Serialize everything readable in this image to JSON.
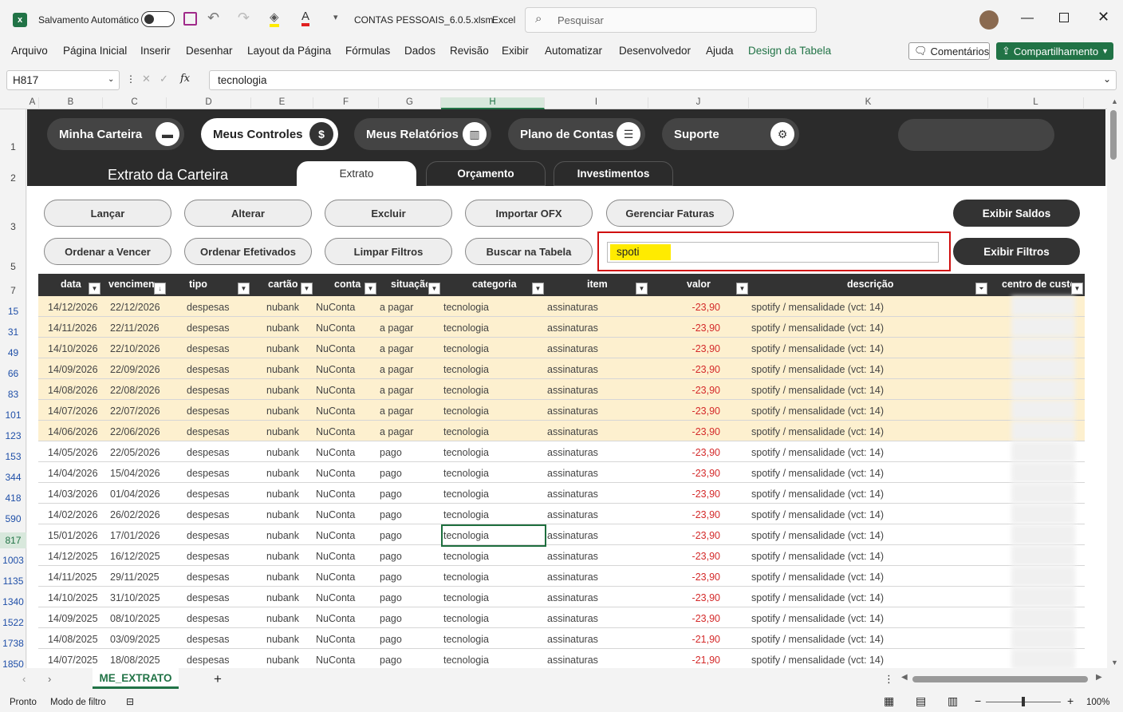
{
  "app": {
    "autosave_label": "Salvamento Automático",
    "file_title": "CONTAS PESSOAIS_6.0.5.xlsm",
    "app_name": "Excel",
    "search_placeholder": "Pesquisar"
  },
  "menu": [
    "Arquivo",
    "Página Inicial",
    "Inserir",
    "Desenhar",
    "Layout da Página",
    "Fórmulas",
    "Dados",
    "Revisão",
    "Exibir",
    "Automatizar",
    "Desenvolvedor",
    "Ajuda",
    "Design da Tabela"
  ],
  "ribbon_right": {
    "comments": "Comentários",
    "share": "Compartilhamento"
  },
  "formula_bar": {
    "name_box": "H817",
    "fx": "fx",
    "value": "tecnologia"
  },
  "columns": [
    "A",
    "B",
    "C",
    "D",
    "E",
    "F",
    "G",
    "H",
    "I",
    "J",
    "K",
    "L"
  ],
  "row_headers": [
    "1",
    "2",
    "3",
    "5",
    "7",
    "15",
    "31",
    "49",
    "66",
    "83",
    "101",
    "123",
    "153",
    "344",
    "418",
    "590",
    "817",
    "1003",
    "1135",
    "1340",
    "1522",
    "1738",
    "1850"
  ],
  "nav": [
    {
      "label": "Minha Carteira",
      "icon": "wallet-icon",
      "glyph": "▬"
    },
    {
      "label": "Meus Controles",
      "icon": "dollar-icon",
      "glyph": "$"
    },
    {
      "label": "Meus Relatórios",
      "icon": "chart-icon",
      "glyph": "▥"
    },
    {
      "label": "Plano de Contas",
      "icon": "list-icon",
      "glyph": "☰"
    },
    {
      "label": "Suporte",
      "icon": "gear-icon",
      "glyph": "⚙"
    }
  ],
  "section_title": "Extrato da Carteira",
  "tabs": [
    "Extrato",
    "Orçamento",
    "Investimentos"
  ],
  "actions_row1": [
    "Lançar",
    "Alterar",
    "Excluir",
    "Importar OFX",
    "Gerenciar Faturas"
  ],
  "actions_row2": [
    "Ordenar a Vencer",
    "Ordenar Efetivados",
    "Limpar Filtros",
    "Buscar na Tabela"
  ],
  "search_value": "spoti",
  "right_buttons": {
    "saldos": "Exibir Saldos",
    "filtros": "Exibir Filtros"
  },
  "table_headers": [
    "data",
    "vencimento",
    "tipo",
    "cartão",
    "conta",
    "situação",
    "categoria",
    "item",
    "valor",
    "descrição",
    "centro de custo"
  ],
  "rows": [
    [
      "14/12/2026",
      "22/12/2026",
      "despesas",
      "nubank",
      "NuConta",
      "a pagar",
      "tecnologia",
      "assinaturas",
      "-23,90",
      "spotify / mensalidade (vct: 14)"
    ],
    [
      "14/11/2026",
      "22/11/2026",
      "despesas",
      "nubank",
      "NuConta",
      "a pagar",
      "tecnologia",
      "assinaturas",
      "-23,90",
      "spotify / mensalidade (vct: 14)"
    ],
    [
      "14/10/2026",
      "22/10/2026",
      "despesas",
      "nubank",
      "NuConta",
      "a pagar",
      "tecnologia",
      "assinaturas",
      "-23,90",
      "spotify / mensalidade (vct: 14)"
    ],
    [
      "14/09/2026",
      "22/09/2026",
      "despesas",
      "nubank",
      "NuConta",
      "a pagar",
      "tecnologia",
      "assinaturas",
      "-23,90",
      "spotify / mensalidade (vct: 14)"
    ],
    [
      "14/08/2026",
      "22/08/2026",
      "despesas",
      "nubank",
      "NuConta",
      "a pagar",
      "tecnologia",
      "assinaturas",
      "-23,90",
      "spotify / mensalidade (vct: 14)"
    ],
    [
      "14/07/2026",
      "22/07/2026",
      "despesas",
      "nubank",
      "NuConta",
      "a pagar",
      "tecnologia",
      "assinaturas",
      "-23,90",
      "spotify / mensalidade (vct: 14)"
    ],
    [
      "14/06/2026",
      "22/06/2026",
      "despesas",
      "nubank",
      "NuConta",
      "a pagar",
      "tecnologia",
      "assinaturas",
      "-23,90",
      "spotify / mensalidade (vct: 14)"
    ],
    [
      "14/05/2026",
      "22/05/2026",
      "despesas",
      "nubank",
      "NuConta",
      "pago",
      "tecnologia",
      "assinaturas",
      "-23,90",
      "spotify / mensalidade (vct: 14)"
    ],
    [
      "14/04/2026",
      "15/04/2026",
      "despesas",
      "nubank",
      "NuConta",
      "pago",
      "tecnologia",
      "assinaturas",
      "-23,90",
      "spotify / mensalidade (vct: 14)"
    ],
    [
      "14/03/2026",
      "01/04/2026",
      "despesas",
      "nubank",
      "NuConta",
      "pago",
      "tecnologia",
      "assinaturas",
      "-23,90",
      "spotify / mensalidade (vct: 14)"
    ],
    [
      "14/02/2026",
      "26/02/2026",
      "despesas",
      "nubank",
      "NuConta",
      "pago",
      "tecnologia",
      "assinaturas",
      "-23,90",
      "spotify / mensalidade (vct: 14)"
    ],
    [
      "15/01/2026",
      "17/01/2026",
      "despesas",
      "nubank",
      "NuConta",
      "pago",
      "tecnologia",
      "assinaturas",
      "-23,90",
      "spotify / mensalidade (vct: 14)"
    ],
    [
      "14/12/2025",
      "16/12/2025",
      "despesas",
      "nubank",
      "NuConta",
      "pago",
      "tecnologia",
      "assinaturas",
      "-23,90",
      "spotify / mensalidade (vct: 14)"
    ],
    [
      "14/11/2025",
      "29/11/2025",
      "despesas",
      "nubank",
      "NuConta",
      "pago",
      "tecnologia",
      "assinaturas",
      "-23,90",
      "spotify / mensalidade (vct: 14)"
    ],
    [
      "14/10/2025",
      "31/10/2025",
      "despesas",
      "nubank",
      "NuConta",
      "pago",
      "tecnologia",
      "assinaturas",
      "-23,90",
      "spotify / mensalidade (vct: 14)"
    ],
    [
      "14/09/2025",
      "08/10/2025",
      "despesas",
      "nubank",
      "NuConta",
      "pago",
      "tecnologia",
      "assinaturas",
      "-23,90",
      "spotify / mensalidade (vct: 14)"
    ],
    [
      "14/08/2025",
      "03/09/2025",
      "despesas",
      "nubank",
      "NuConta",
      "pago",
      "tecnologia",
      "assinaturas",
      "-21,90",
      "spotify / mensalidade (vct: 14)"
    ],
    [
      "14/07/2025",
      "18/08/2025",
      "despesas",
      "nubank",
      "NuConta",
      "pago",
      "tecnologia",
      "assinaturas",
      "-21,90",
      "spotify / mensalidade (vct: 14)"
    ]
  ],
  "highlighted_rows": 7,
  "sheet_tab": "ME_EXTRATO",
  "status": {
    "ready": "Pronto",
    "filter_mode": "Modo de filtro",
    "zoom": "100%"
  },
  "colors": {
    "accent": "#217346",
    "dark": "#2b2b2b",
    "highlight": "#fdf0cf",
    "negative": "#d42a2a",
    "search_box": "#ffeb00",
    "red_outline": "#d01010"
  }
}
